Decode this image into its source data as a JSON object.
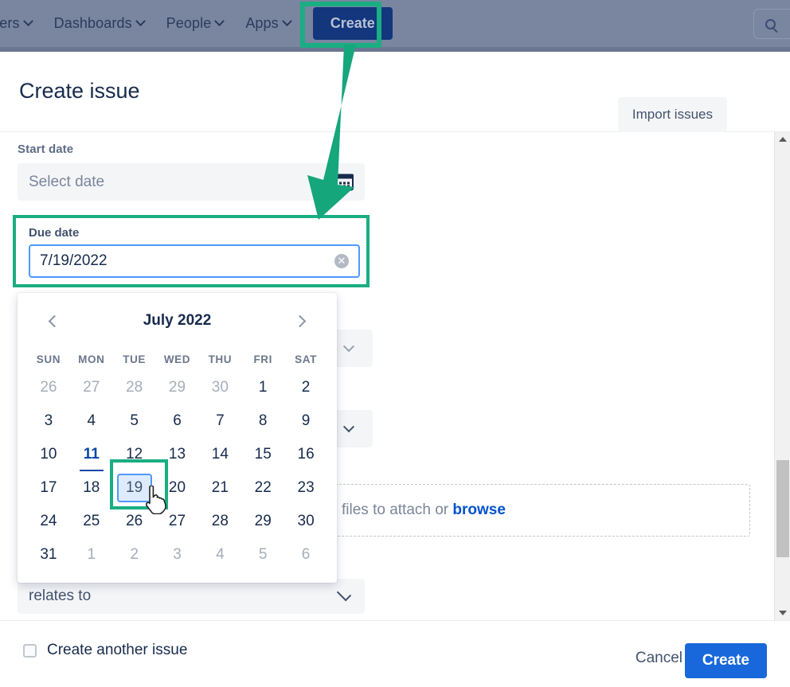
{
  "navbar": {
    "items": [
      {
        "label": "ilters",
        "has_chevron": true
      },
      {
        "label": "Dashboards",
        "has_chevron": true
      },
      {
        "label": "People",
        "has_chevron": true
      },
      {
        "label": "Apps",
        "has_chevron": true
      }
    ],
    "create_label": "Create",
    "search_icon": "search-icon"
  },
  "modal": {
    "title": "Create issue",
    "import_label": "Import issues",
    "more_label": "•••"
  },
  "form": {
    "start_date": {
      "label": "Start date",
      "placeholder": "Select date",
      "value": "",
      "icon": "calendar-icon"
    },
    "due_date": {
      "label": "Due date",
      "value": "7/19/2022",
      "clear_icon": "clear-circle-icon"
    },
    "attachment": {
      "text_prefix": "files to attach or ",
      "browse_label": "browse"
    },
    "linked_issue": {
      "value": "relates to"
    }
  },
  "calendar": {
    "month_label": "July 2022",
    "prev_icon": "chevron-left-icon",
    "next_icon": "chevron-right-icon",
    "day_headers": [
      "SUN",
      "MON",
      "TUE",
      "WED",
      "THU",
      "FRI",
      "SAT"
    ],
    "today": 11,
    "selected": 19,
    "weeks": [
      [
        {
          "d": 26,
          "o": true
        },
        {
          "d": 27,
          "o": true
        },
        {
          "d": 28,
          "o": true
        },
        {
          "d": 29,
          "o": true
        },
        {
          "d": 30,
          "o": true
        },
        {
          "d": 1
        },
        {
          "d": 2
        }
      ],
      [
        {
          "d": 3
        },
        {
          "d": 4
        },
        {
          "d": 5
        },
        {
          "d": 6
        },
        {
          "d": 7
        },
        {
          "d": 8
        },
        {
          "d": 9
        }
      ],
      [
        {
          "d": 10
        },
        {
          "d": 11,
          "today": true
        },
        {
          "d": 12
        },
        {
          "d": 13
        },
        {
          "d": 14
        },
        {
          "d": 15
        },
        {
          "d": 16
        }
      ],
      [
        {
          "d": 17
        },
        {
          "d": 18
        },
        {
          "d": 19,
          "selected": true
        },
        {
          "d": 20
        },
        {
          "d": 21
        },
        {
          "d": 22
        },
        {
          "d": 23
        }
      ],
      [
        {
          "d": 24
        },
        {
          "d": 25
        },
        {
          "d": 26
        },
        {
          "d": 27
        },
        {
          "d": 28
        },
        {
          "d": 29
        },
        {
          "d": 30
        }
      ],
      [
        {
          "d": 31
        },
        {
          "d": 1,
          "o": true
        },
        {
          "d": 2,
          "o": true
        },
        {
          "d": 3,
          "o": true
        },
        {
          "d": 4,
          "o": true
        },
        {
          "d": 5,
          "o": true
        },
        {
          "d": 6,
          "o": true
        }
      ]
    ]
  },
  "footer": {
    "create_another_label": "Create another issue",
    "create_another_checked": false,
    "cancel_label": "Cancel",
    "create_label": "Create"
  },
  "colors": {
    "annotation_green": "#1aae82",
    "nav_background": "#7a85a0",
    "nav_create_blue": "#13367d",
    "primary_blue": "#1868db",
    "focus_blue": "#4c9aff",
    "selected_day_bg": "#deebff",
    "today_blue": "#0747a6",
    "link_blue": "#0052cc"
  }
}
